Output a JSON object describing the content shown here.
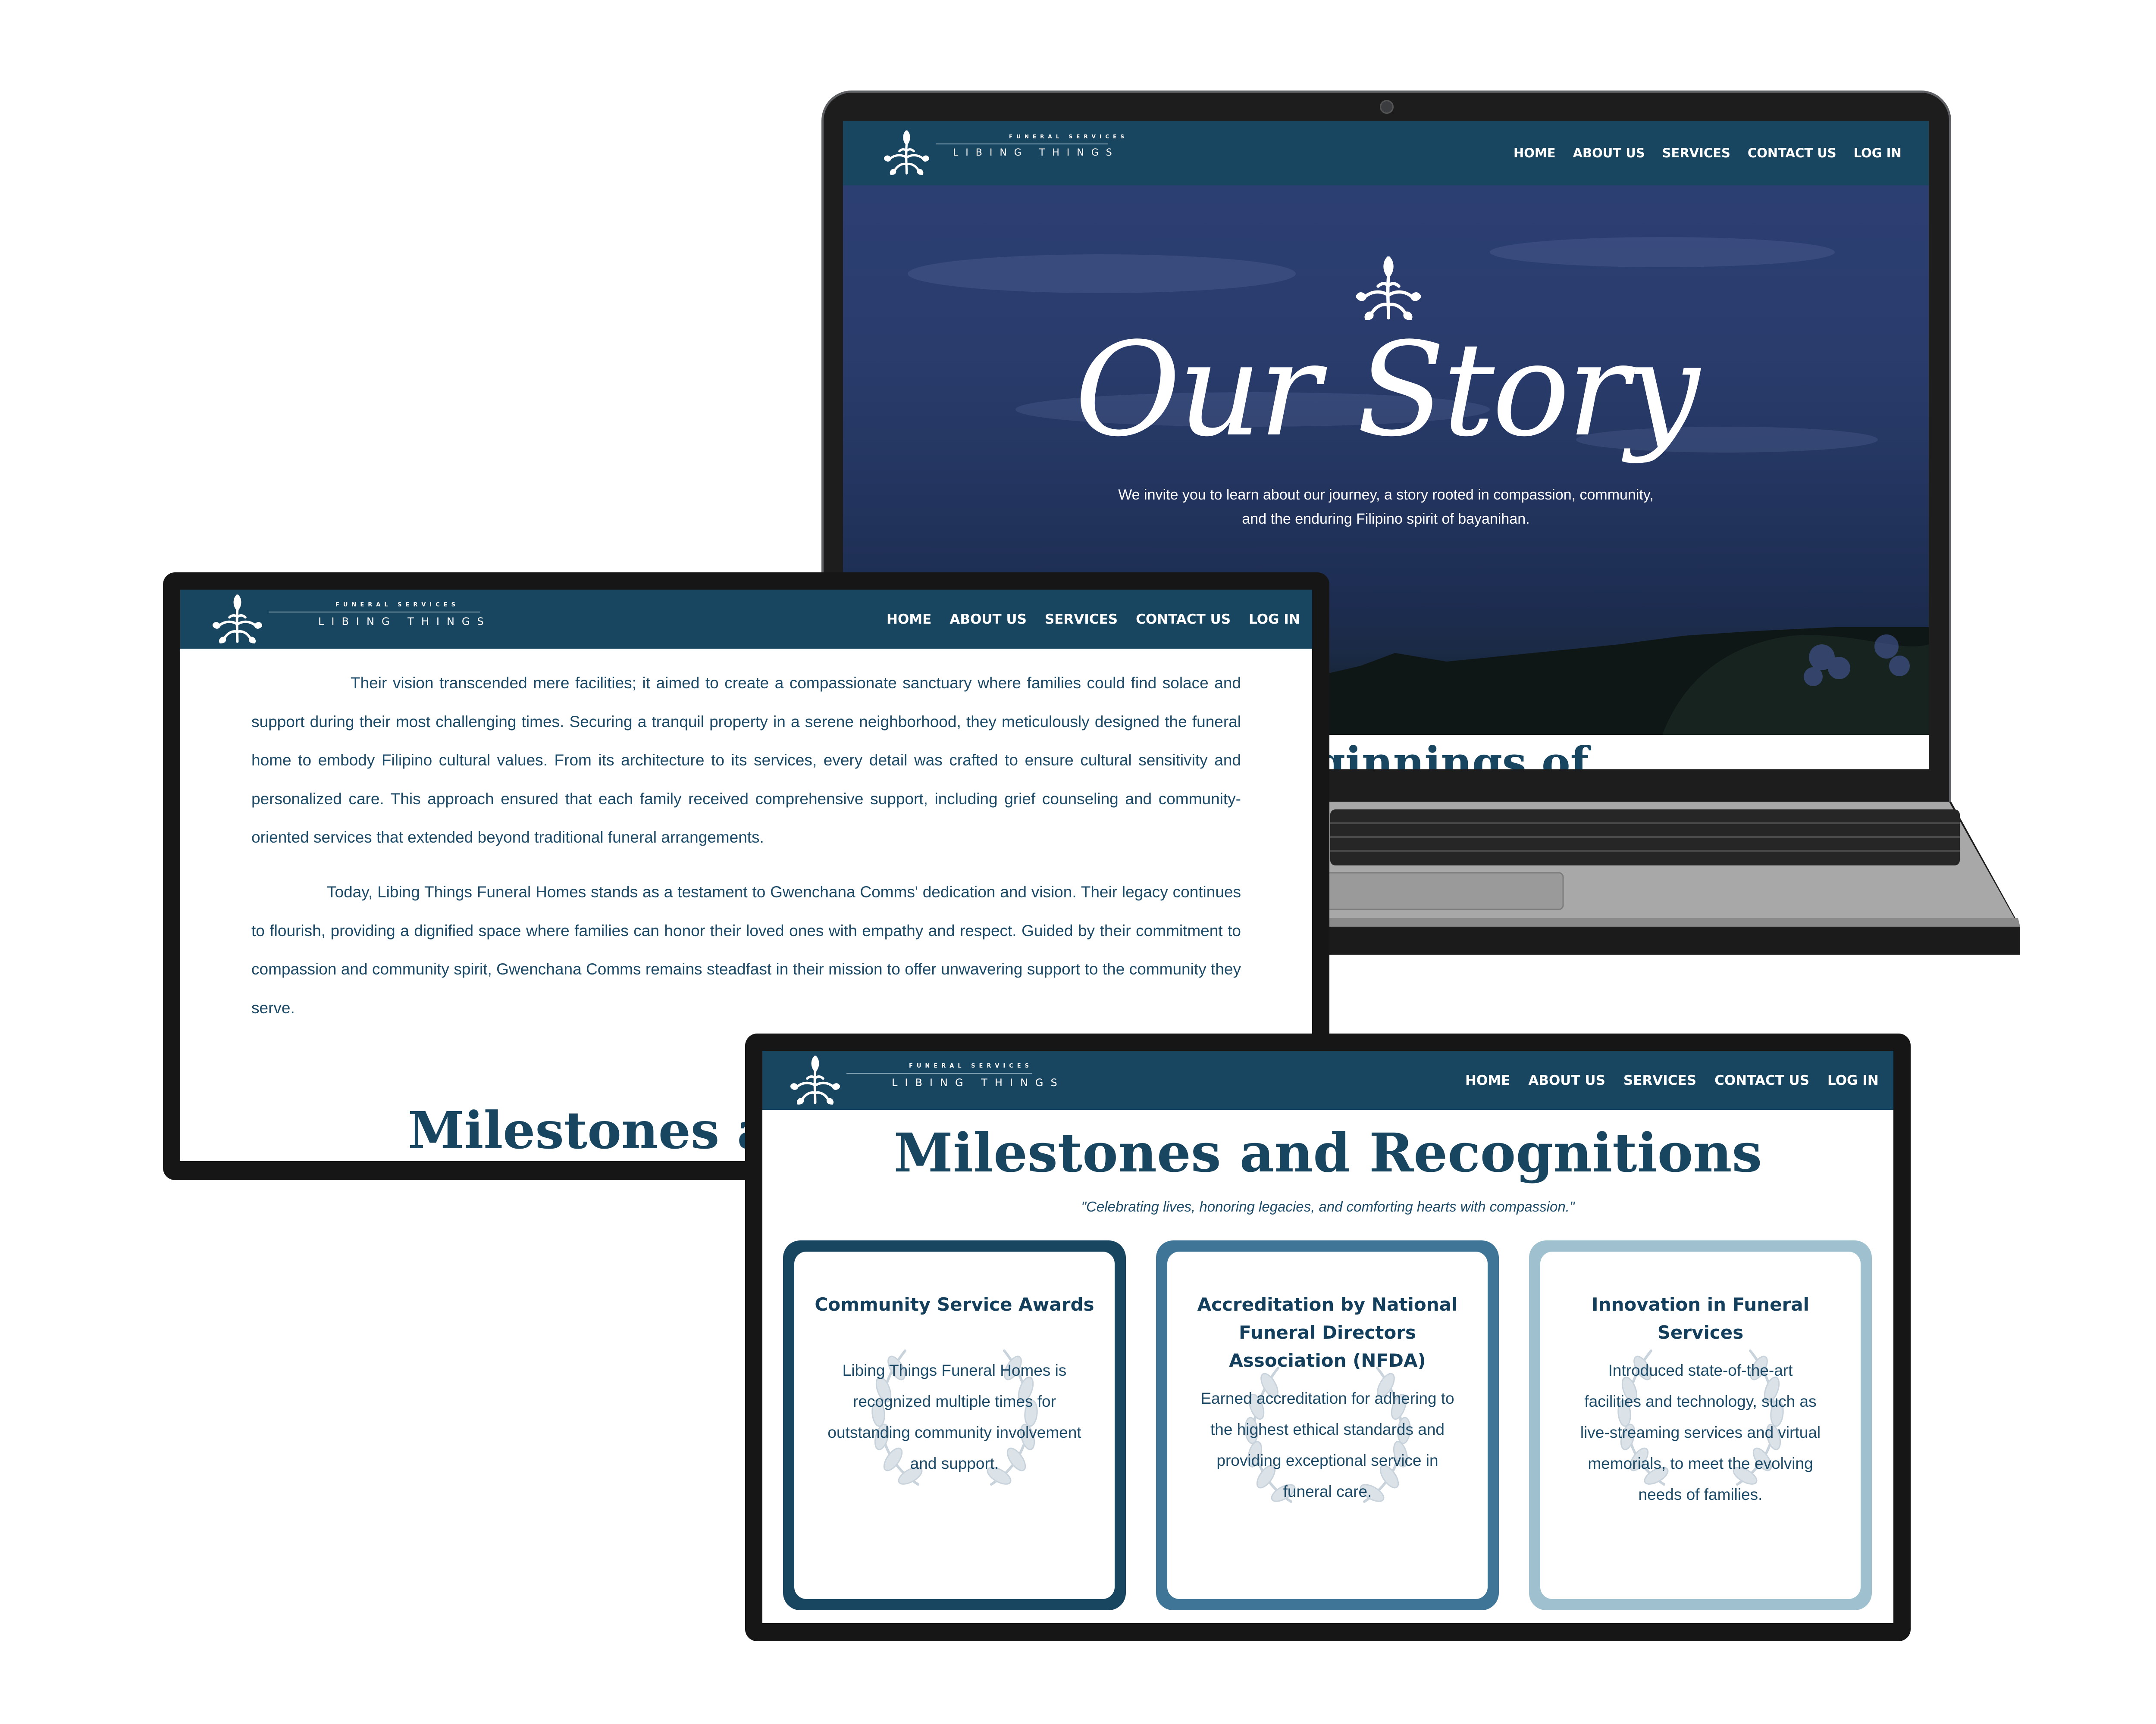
{
  "brand": {
    "tagline": "FUNERAL SERVICES",
    "name": "LIBING THINGS"
  },
  "nav": {
    "home": "HOME",
    "about": "ABOUT US",
    "services": "SERVICES",
    "contact": "CONTACT US",
    "login": "LOG IN"
  },
  "hero": {
    "title": "Our Story",
    "subtitle_line1": "We invite you to learn about our journey, a story rooted in compassion, community,",
    "subtitle_line2": "and the enduring Filipino spirit of bayanihan."
  },
  "laptop_peek_heading": "ginnings of",
  "story": {
    "paragraph1": "Their vision transcended mere facilities; it aimed to create a compassionate sanctuary where families could find solace and support during their most challenging times. Securing a tranquil property in a serene neighborhood, they meticulously designed the funeral home to embody Filipino cultural values. From its architecture to its services, every detail was crafted to ensure cultural sensitivity and personalized care. This approach ensured that each family received comprehensive support, including grief counseling and community-oriented services that extended beyond traditional funeral arrangements.",
    "paragraph2": "Today, Libing Things Funeral Homes stands as a testament to Gwenchana Comms' dedication and vision. Their legacy continues to flourish, providing a dignified space where families can honor their loved ones with empathy and respect. Guided by their commitment to compassion and community spirit, Gwenchana Comms remains steadfast in their mission to offer unwavering support to the community they serve.",
    "peek_heading": "Milestones and"
  },
  "milestones": {
    "title": "Milestones and Recognitions",
    "quote": "\"Celebrating lives, honoring legacies, and comforting hearts with compassion.\"",
    "cards": [
      {
        "title": "Community Service Awards",
        "body": "Libing Things Funeral Homes is recognized multiple times for outstanding community involvement and support.",
        "border_color": "#18455f"
      },
      {
        "title": "Accreditation by National Funeral Directors Association (NFDA)",
        "body": "Earned accreditation for adhering to the highest ethical standards and providing exceptional service in funeral care.",
        "border_color": "#3f7596"
      },
      {
        "title": "Innovation in Funeral Services",
        "body": "Introduced state-of-the-art facilities and technology, such as live-streaming services and virtual memorials, to meet the evolving needs of families.",
        "border_color": "#9fc1cf"
      }
    ]
  },
  "colors": {
    "header_navy": "#18455f",
    "heading_navy": "#18455f",
    "body_text": "#1c4a66",
    "device_frame": "#161616"
  },
  "icons": {
    "logo_mark": "sprig-leaf-icon",
    "card_decoration": "laurel-wreath-icon"
  }
}
